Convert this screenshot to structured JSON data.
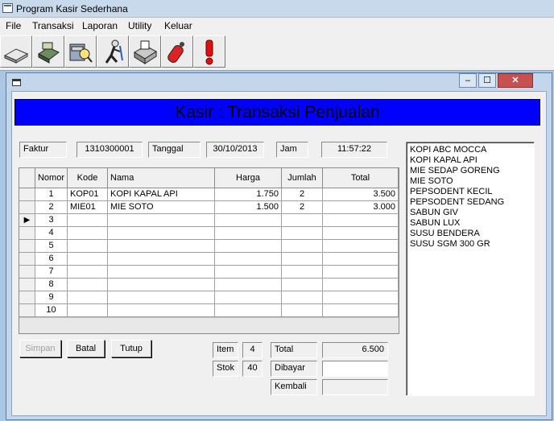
{
  "app": {
    "title": "Program Kasir Sederhana",
    "menu": [
      "File",
      "Transaksi",
      "Laporan",
      "Utility",
      "Keluar"
    ]
  },
  "toolbar": {
    "buttons": [
      "open-book-icon",
      "cash-register-icon",
      "search-drawer-icon",
      "user-run-icon",
      "fax-machine-icon",
      "fire-extinguisher-icon",
      "exclamation-icon"
    ]
  },
  "child": {
    "title_buttons": {
      "minimize": "–",
      "maximize": "☐",
      "close": "✕"
    }
  },
  "banner": {
    "title": "Kasir : Transaksi Penjualan"
  },
  "info": {
    "faktur_label": "Faktur",
    "faktur_value": "1310300001",
    "tanggal_label": "Tanggal",
    "tanggal_value": "30/10/2013",
    "jam_label": "Jam",
    "jam_value": "11:57:22"
  },
  "grid": {
    "columns": [
      "",
      "Nomor",
      "Kode",
      "Nama",
      "Harga",
      "Jumlah",
      "Total"
    ],
    "rows": [
      {
        "nomor": "1",
        "kode": "KOP01",
        "nama": "KOPI KAPAL API",
        "harga": "1.750",
        "jumlah": "2",
        "total": "3.500"
      },
      {
        "nomor": "2",
        "kode": "MIE01",
        "nama": "MIE SOTO",
        "harga": "1.500",
        "jumlah": "2",
        "total": "3.000"
      },
      {
        "nomor": "3",
        "kode": "",
        "nama": "",
        "harga": "",
        "jumlah": "",
        "total": "",
        "current": true
      },
      {
        "nomor": "4",
        "kode": "",
        "nama": "",
        "harga": "",
        "jumlah": "",
        "total": ""
      },
      {
        "nomor": "5",
        "kode": "",
        "nama": "",
        "harga": "",
        "jumlah": "",
        "total": ""
      },
      {
        "nomor": "6",
        "kode": "",
        "nama": "",
        "harga": "",
        "jumlah": "",
        "total": ""
      },
      {
        "nomor": "7",
        "kode": "",
        "nama": "",
        "harga": "",
        "jumlah": "",
        "total": ""
      },
      {
        "nomor": "8",
        "kode": "",
        "nama": "",
        "harga": "",
        "jumlah": "",
        "total": ""
      },
      {
        "nomor": "9",
        "kode": "",
        "nama": "",
        "harga": "",
        "jumlah": "",
        "total": ""
      },
      {
        "nomor": "10",
        "kode": "",
        "nama": "",
        "harga": "",
        "jumlah": "",
        "total": ""
      }
    ],
    "row_indicator": "▶"
  },
  "buttons": {
    "simpan": "Simpan",
    "batal": "Batal",
    "tutup": "Tutup"
  },
  "summary": {
    "item_label": "Item",
    "item_value": "4",
    "stok_label": "Stok",
    "stok_value": "40",
    "total_label": "Total",
    "total_value": "6.500",
    "dibayar_label": "Dibayar",
    "dibayar_value": "",
    "kembali_label": "Kembali",
    "kembali_value": ""
  },
  "products": [
    "KOPI ABC MOCCA",
    "KOPI KAPAL API",
    "MIE SEDAP GORENG",
    "MIE SOTO",
    "PEPSODENT KECIL",
    "PEPSODENT SEDANG",
    "SABUN GIV",
    "SABUN LUX",
    "SUSU BENDERA",
    "SUSU SGM 300 GR"
  ]
}
